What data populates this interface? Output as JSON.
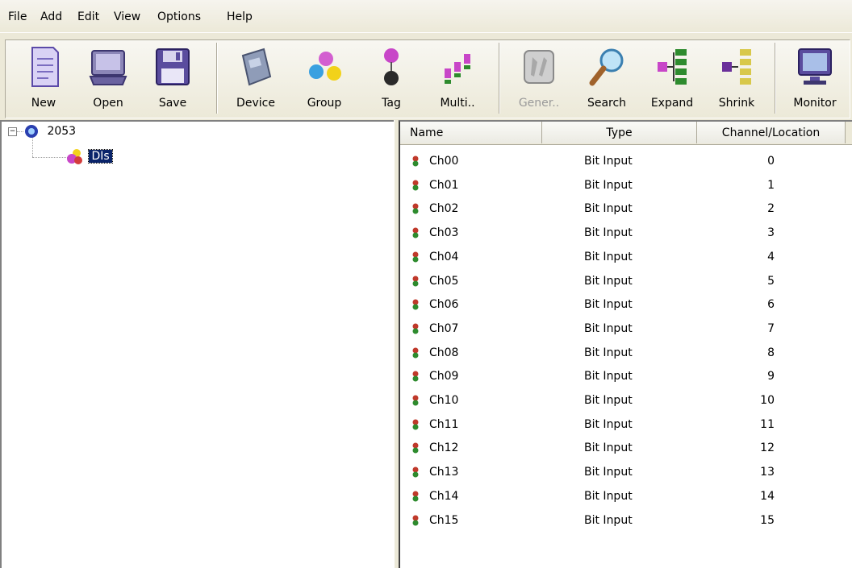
{
  "menu": [
    "File",
    "Add",
    "Edit",
    "View",
    "Options",
    "Help"
  ],
  "toolbar": [
    {
      "label": "New",
      "icon": "new-document-icon",
      "enabled": true
    },
    {
      "label": "Open",
      "icon": "open-folder-icon",
      "enabled": true
    },
    {
      "label": "Save",
      "icon": "floppy-disk-icon",
      "enabled": true
    },
    {
      "label": "Device",
      "icon": "device-module-icon",
      "enabled": true
    },
    {
      "label": "Group",
      "icon": "group-dots-icon",
      "enabled": true
    },
    {
      "label": "Tag",
      "icon": "tag-pin-icon",
      "enabled": true
    },
    {
      "label": "Multi..",
      "icon": "multi-tags-icon",
      "enabled": true
    },
    {
      "label": "Gener..",
      "icon": "generate-wrench-icon",
      "enabled": false
    },
    {
      "label": "Search",
      "icon": "magnifier-icon",
      "enabled": true
    },
    {
      "label": "Expand",
      "icon": "expand-tree-icon",
      "enabled": true
    },
    {
      "label": "Shrink",
      "icon": "shrink-tree-icon",
      "enabled": true
    },
    {
      "label": "Monitor",
      "icon": "monitor-icon",
      "enabled": true
    }
  ],
  "tree": {
    "root": {
      "label": "2053",
      "expander": "−",
      "icon": "device-node-icon"
    },
    "child": {
      "label": "DIs",
      "icon": "group-node-icon",
      "selected": true
    }
  },
  "list": {
    "columns": [
      "Name",
      "Type",
      "Channel/Location"
    ],
    "rows": [
      {
        "name": "Ch00",
        "type": "Bit Input",
        "loc": "0"
      },
      {
        "name": "Ch01",
        "type": "Bit Input",
        "loc": "1"
      },
      {
        "name": "Ch02",
        "type": "Bit Input",
        "loc": "2"
      },
      {
        "name": "Ch03",
        "type": "Bit Input",
        "loc": "3"
      },
      {
        "name": "Ch04",
        "type": "Bit Input",
        "loc": "4"
      },
      {
        "name": "Ch05",
        "type": "Bit Input",
        "loc": "5"
      },
      {
        "name": "Ch06",
        "type": "Bit Input",
        "loc": "6"
      },
      {
        "name": "Ch07",
        "type": "Bit Input",
        "loc": "7"
      },
      {
        "name": "Ch08",
        "type": "Bit Input",
        "loc": "8"
      },
      {
        "name": "Ch09",
        "type": "Bit Input",
        "loc": "9"
      },
      {
        "name": "Ch10",
        "type": "Bit Input",
        "loc": "10"
      },
      {
        "name": "Ch11",
        "type": "Bit Input",
        "loc": "11"
      },
      {
        "name": "Ch12",
        "type": "Bit Input",
        "loc": "12"
      },
      {
        "name": "Ch13",
        "type": "Bit Input",
        "loc": "13"
      },
      {
        "name": "Ch14",
        "type": "Bit Input",
        "loc": "14"
      },
      {
        "name": "Ch15",
        "type": "Bit Input",
        "loc": "15"
      }
    ]
  },
  "colors": {
    "selection": "#0a246a",
    "chrome": "#ece9d8",
    "tag_red": "#c0392b",
    "tag_green": "#2e8b2e"
  }
}
